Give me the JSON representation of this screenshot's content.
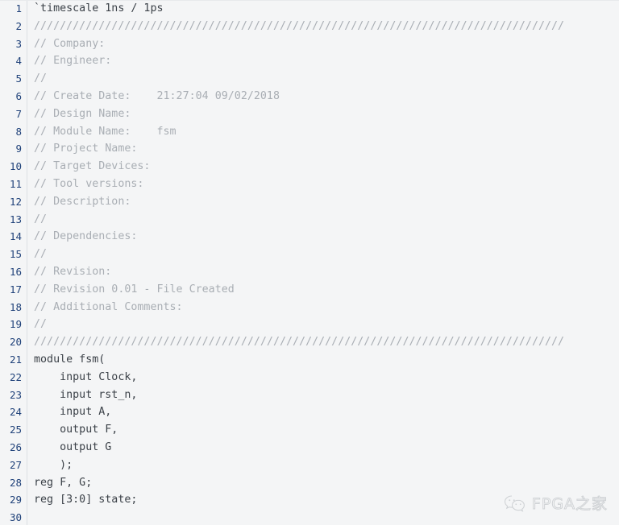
{
  "editor": {
    "language": "verilog",
    "colors": {
      "background": "#f4f5f6",
      "gutter_text": "#20427a",
      "gutter_divider": "#dcdfe3",
      "code_text": "#3b4148",
      "comment_text": "#a9aeb4"
    },
    "first_line_number": 1,
    "last_line_number": 30,
    "lines": [
      {
        "num": "1",
        "text": "`timescale 1ns / 1ps",
        "kind": "code"
      },
      {
        "num": "2",
        "text": "//////////////////////////////////////////////////////////////////////////////////",
        "kind": "comment"
      },
      {
        "num": "3",
        "text": "// Company: ",
        "kind": "comment"
      },
      {
        "num": "4",
        "text": "// Engineer: ",
        "kind": "comment"
      },
      {
        "num": "5",
        "text": "// ",
        "kind": "comment"
      },
      {
        "num": "6",
        "text": "// Create Date:    21:27:04 09/02/2018 ",
        "kind": "comment"
      },
      {
        "num": "7",
        "text": "// Design Name: ",
        "kind": "comment"
      },
      {
        "num": "8",
        "text": "// Module Name:    fsm ",
        "kind": "comment"
      },
      {
        "num": "9",
        "text": "// Project Name: ",
        "kind": "comment"
      },
      {
        "num": "10",
        "text": "// Target Devices: ",
        "kind": "comment"
      },
      {
        "num": "11",
        "text": "// Tool versions: ",
        "kind": "comment"
      },
      {
        "num": "12",
        "text": "// Description: ",
        "kind": "comment"
      },
      {
        "num": "13",
        "text": "//",
        "kind": "comment"
      },
      {
        "num": "14",
        "text": "// Dependencies: ",
        "kind": "comment"
      },
      {
        "num": "15",
        "text": "//",
        "kind": "comment"
      },
      {
        "num": "16",
        "text": "// Revision: ",
        "kind": "comment"
      },
      {
        "num": "17",
        "text": "// Revision 0.01 - File Created",
        "kind": "comment"
      },
      {
        "num": "18",
        "text": "// Additional Comments: ",
        "kind": "comment"
      },
      {
        "num": "19",
        "text": "//",
        "kind": "comment"
      },
      {
        "num": "20",
        "text": "//////////////////////////////////////////////////////////////////////////////////",
        "kind": "comment"
      },
      {
        "num": "21",
        "text": "module fsm(",
        "kind": "code"
      },
      {
        "num": "22",
        "text": "    input Clock,",
        "kind": "code"
      },
      {
        "num": "23",
        "text": "    input rst_n,",
        "kind": "code"
      },
      {
        "num": "24",
        "text": "    input A,",
        "kind": "code"
      },
      {
        "num": "25",
        "text": "    output F,",
        "kind": "code"
      },
      {
        "num": "26",
        "text": "    output G",
        "kind": "code"
      },
      {
        "num": "27",
        "text": "    );",
        "kind": "code"
      },
      {
        "num": "28",
        "text": "reg F, G;",
        "kind": "code"
      },
      {
        "num": "29",
        "text": "reg [3:0] state;",
        "kind": "code"
      },
      {
        "num": "30",
        "text": "",
        "kind": "code"
      }
    ]
  },
  "watermark": {
    "text": "FPGA之家",
    "icon": "wechat-icon",
    "color": "#9aa0a6"
  }
}
